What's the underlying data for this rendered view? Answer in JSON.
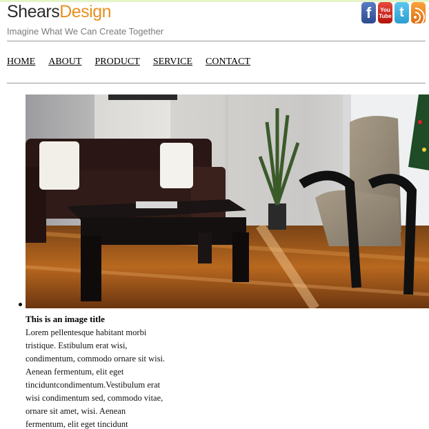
{
  "brand": {
    "name_part1": "Shears",
    "name_part2": "Design",
    "tagline": "Imagine What We Can Create Together"
  },
  "social": [
    {
      "name": "facebook",
      "glyph": "f"
    },
    {
      "name": "youtube",
      "glyph_top": "You",
      "glyph_bottom": "Tube"
    },
    {
      "name": "twitter",
      "glyph": "t"
    },
    {
      "name": "rss",
      "glyph": ""
    }
  ],
  "nav": {
    "items": [
      "HOME",
      "ABOUT",
      "PRODUCT",
      "SERVICE",
      "CONTACT"
    ]
  },
  "slideshow": {
    "image_icon": "living-room-photo",
    "caption_title": "This is an image title",
    "caption_text": "Lorem pellentesque habitant morbi tristique. Estibulum erat wisi, condimentum, commodo ornare sit wisi. Aenean fermentum, elit eget tinciduntcondimentum.Vestibulum erat wisi condimentum sed, commodo vitae, ornare sit amet, wisi. Aenean fermentum, elit eget tincidunt condimentum."
  },
  "colors": {
    "brand_orange": "#e7901e",
    "brand_dark": "#2b2b2b",
    "tagline_gray": "#7a7a7a"
  }
}
